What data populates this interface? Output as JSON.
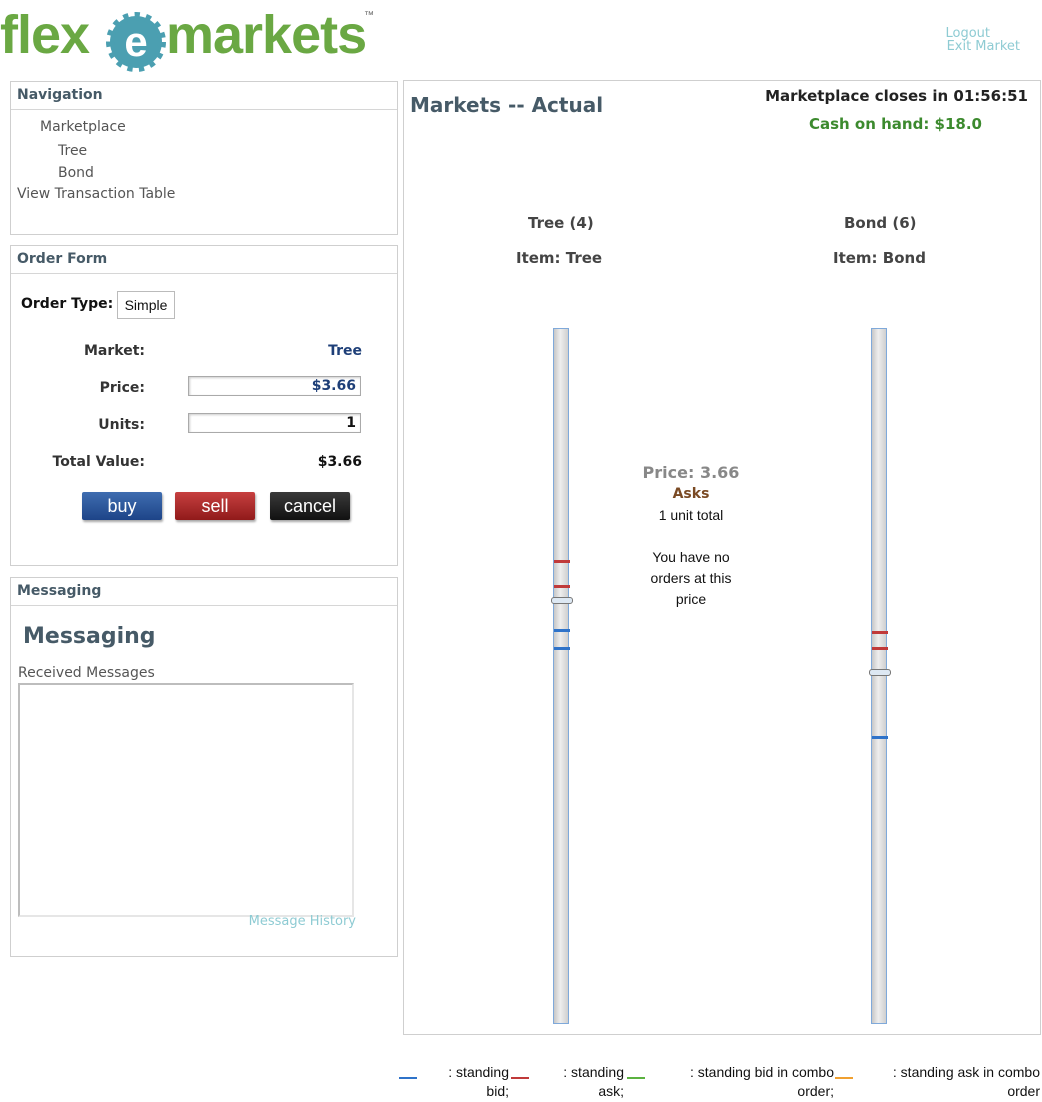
{
  "brand": {
    "logo_text_left": "flex",
    "logo_text_right": "markets",
    "trademark": "™"
  },
  "top_links": {
    "logout": "Logout",
    "exit_market": "Exit Market"
  },
  "navigation": {
    "title": "Navigation",
    "items": [
      "Marketplace",
      "Tree",
      "Bond",
      "View Transaction Table"
    ]
  },
  "order_form": {
    "title": "Order Form",
    "order_type_label": "Order Type:",
    "order_type_value": "Simple",
    "market_label": "Market:",
    "market_value": "Tree",
    "price_label": "Price:",
    "price_value": "$3.66",
    "units_label": "Units:",
    "units_value": "1",
    "total_label": "Total Value:",
    "total_value": "$3.66",
    "buy_label": "buy",
    "sell_label": "sell",
    "cancel_label": "cancel"
  },
  "messaging": {
    "title": "Messaging",
    "heading": "Messaging",
    "received_label": "Received Messages",
    "history_link": "Message History"
  },
  "markets": {
    "title": "Markets -- Actual",
    "closes": "Marketplace closes in 01:56:51",
    "cash": "Cash on hand: $18.0",
    "tree": {
      "name": "Tree (4)",
      "item": "Item: Tree"
    },
    "bond": {
      "name": "Bond (6)",
      "item": "Item: Bond"
    },
    "info": {
      "price": "Price: 3.66",
      "side": "Asks",
      "units_total": "1 unit total",
      "no_orders": "You have no orders at this price"
    }
  },
  "legend": {
    "bid": ": standing bid;",
    "ask": ": standing ask;",
    "combo_bid": ": standing bid in combo order;",
    "combo_ask": ": standing ask in combo order"
  },
  "colors": {
    "brand_green": "#6aa843",
    "bid_blue": "#2f73c9",
    "ask_red": "#c03a3a",
    "combo_bid_green": "#5bb240",
    "combo_ask_orange": "#f0a030",
    "cash_green": "#3c8a2e",
    "market_link_blue": "#1e3f78",
    "asks_brown": "#7a4a24"
  }
}
